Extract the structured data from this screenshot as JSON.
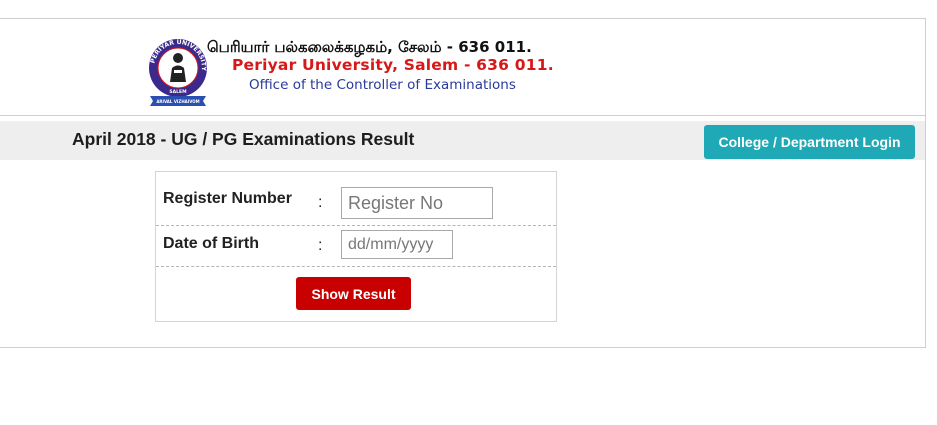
{
  "header": {
    "name_tamil": "பெரியார் பல்கலைக்கழகம், சேலம் - 636 011.",
    "name_english": "Periyar University, Salem - 636 011.",
    "office": "Office of the Controller of Examinations",
    "logo": {
      "icon": "university-seal-icon",
      "ring_text": "PERIYAR UNIVERSITY",
      "bottom_text": "SALEM",
      "ribbon_text": "ARIVAL VIZHAIVOM",
      "colors": {
        "ring": "#3b2a8c",
        "center": "#ffffff",
        "ribbon": "#2a4fb0",
        "accent": "#d81818"
      }
    }
  },
  "titlebar": {
    "title": "April 2018 - UG / PG Examinations Result",
    "login_button_label": "College / Department Login"
  },
  "form": {
    "register_label": "Register Number",
    "register_colon": ":",
    "register_placeholder": "Register No",
    "register_value": "",
    "dob_label": "Date of Birth",
    "dob_colon": ":",
    "dob_placeholder": "dd/mm/yyyy",
    "dob_value": "",
    "submit_label": "Show Result"
  },
  "colors": {
    "login_button": "#1fa8b6",
    "submit_button": "#c80000",
    "university_name_english": "#d81818",
    "office_text": "#2a3a9a",
    "titlebar_bg": "#eeeeee"
  }
}
